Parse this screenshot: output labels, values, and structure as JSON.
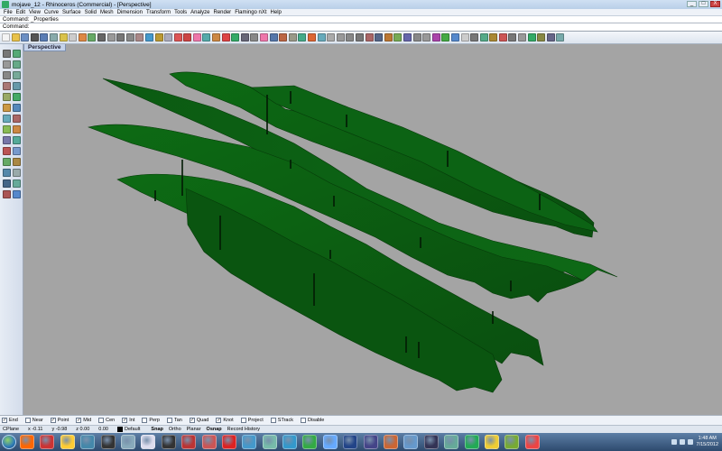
{
  "window": {
    "title": "mojave_12 - Rhinoceros (Commercial) - [Perspective]",
    "buttons": [
      "_",
      "□",
      "X"
    ]
  },
  "menu": [
    "File",
    "Edit",
    "View",
    "Curve",
    "Surface",
    "Solid",
    "Mesh",
    "Dimension",
    "Transform",
    "Tools",
    "Analyze",
    "Render",
    "Flamingo nXt",
    "Help"
  ],
  "command": {
    "history": "Command: _Properties",
    "prompt": "Command:"
  },
  "toolbar_colors": [
    "#f4f4f4",
    "#e8c24a",
    "#6b8fc4",
    "#555",
    "#5a7db5",
    "#8aa",
    "#d9c24a",
    "#ccc",
    "#d84",
    "#6a6",
    "#666",
    "#999",
    "#777",
    "#888",
    "#a88",
    "#49c",
    "#b93",
    "#aab",
    "#d55",
    "#c44",
    "#e7a",
    "#5aa",
    "#c84",
    "#d44",
    "#3a6",
    "#667",
    "#888",
    "#e7a",
    "#57a",
    "#b64",
    "#998",
    "#4a8",
    "#d63",
    "#6ab",
    "#aaa",
    "#999",
    "#888",
    "#777",
    "#a66",
    "#568",
    "#b73",
    "#7a5",
    "#66a",
    "#888",
    "#999",
    "#a4a",
    "#4a4",
    "#58c",
    "#ccc",
    "#777",
    "#5a8",
    "#a83",
    "#c55",
    "#777",
    "#999",
    "#3a6",
    "#884",
    "#668",
    "#7aa"
  ],
  "viewport": {
    "name": "Perspective"
  },
  "osnaps": [
    {
      "label": "End",
      "checked": true
    },
    {
      "label": "Near",
      "checked": false
    },
    {
      "label": "Point",
      "checked": true
    },
    {
      "label": "Mid",
      "checked": true
    },
    {
      "label": "Cen",
      "checked": false
    },
    {
      "label": "Int",
      "checked": true
    },
    {
      "label": "Perp",
      "checked": false
    },
    {
      "label": "Tan",
      "checked": false
    },
    {
      "label": "Quad",
      "checked": true
    },
    {
      "label": "Knot",
      "checked": true
    },
    {
      "label": "Project",
      "checked": false
    },
    {
      "label": "STrack",
      "checked": false
    },
    {
      "label": "Disable",
      "checked": false
    }
  ],
  "status": {
    "cplane": "CPlane",
    "x": "x -0.11",
    "y": "y -0.98",
    "z": "z 0.00",
    "w": "0.00",
    "layer": "Default",
    "panes": [
      "Snap",
      "Ortho",
      "Planar",
      "Osnap",
      "Record History"
    ]
  },
  "taskbar": {
    "app_colors": [
      "#f60",
      "#c33",
      "#fc3",
      "#48a",
      "#333",
      "#8ab",
      "#dde",
      "#333",
      "#b33",
      "#c55",
      "#d22",
      "#49c",
      "#7ba",
      "#39c",
      "#3a4",
      "#6af",
      "#248",
      "#448",
      "#c63",
      "#69c",
      "#335",
      "#6a9",
      "#2a5",
      "#ec3",
      "#7a3",
      "#e44"
    ],
    "time": "1:48 AM",
    "date": "7/15/2012"
  }
}
